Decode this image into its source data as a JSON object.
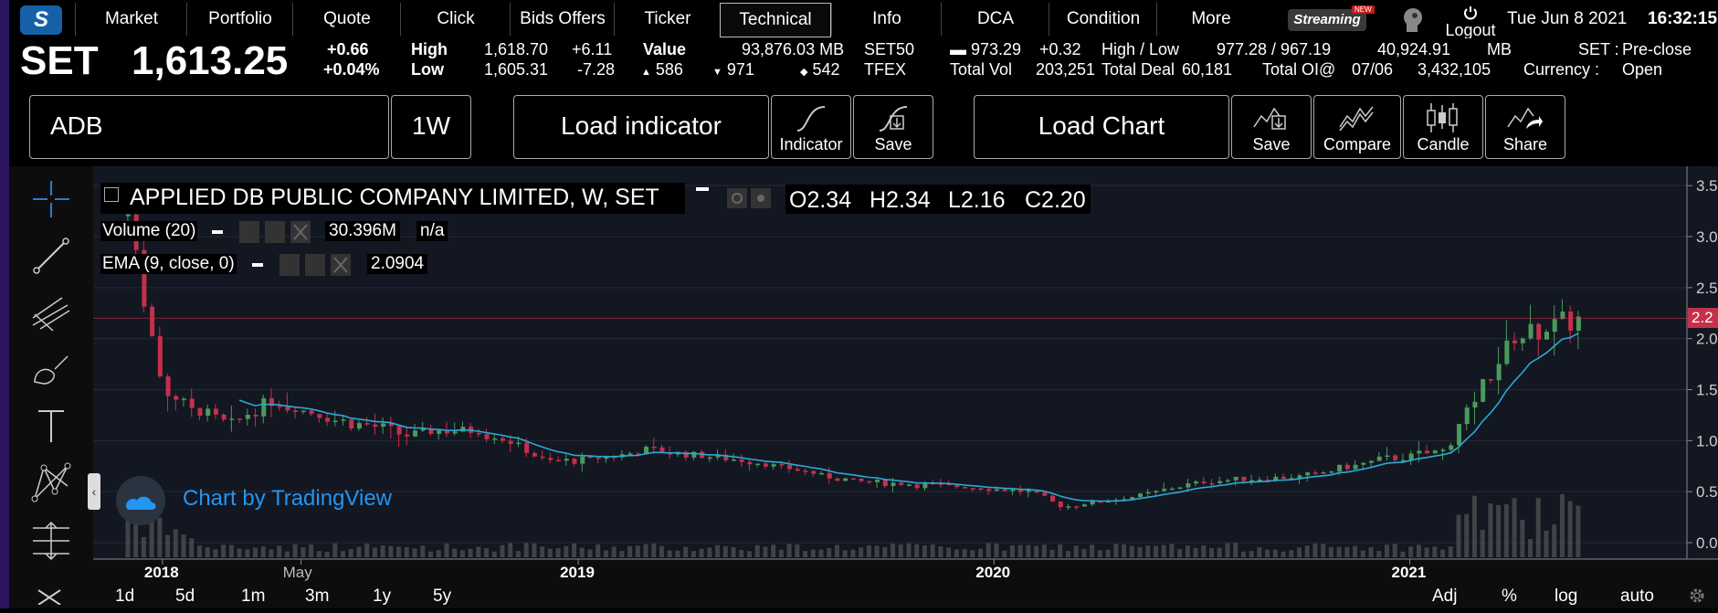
{
  "nav": {
    "logo_letter": "S",
    "items": [
      "Market",
      "Portfolio",
      "Quote",
      "Click",
      "Bids Offers",
      "Ticker",
      "Technical",
      "Info",
      "DCA",
      "Condition",
      "More"
    ],
    "active": "Technical",
    "streaming_label": "Streaming",
    "new_badge": "NEW",
    "logout_label": "Logout",
    "date": "Tue Jun 8 2021",
    "time": "16:32:15"
  },
  "market": {
    "index_name": "SET",
    "index_value": "1,613.25",
    "change": "+0.66",
    "change_pct": "+0.04%",
    "high_label": "High",
    "high_value": "1,618.70",
    "high_change": "+6.11",
    "low_label": "Low",
    "low_value": "1,605.31",
    "low_change": "-7.28",
    "value_label": "Value",
    "value_amount": "93,876.03 MB",
    "up_count": "586",
    "down_count": "971",
    "unchanged_count": "542",
    "set50_label": "SET50",
    "set50_value": "973.29",
    "set50_change": "+0.32",
    "highlow_label": "High / Low",
    "highlow_value": "977.28  /  967.19",
    "set50_amount": "40,924.91",
    "set50_unit": "MB",
    "set_status_label": "SET :",
    "set_status": "Pre-close",
    "tfex_label": "TFEX",
    "totalvol_label": "Total Vol",
    "totalvol_value": "203,251",
    "totaldeal_label": "Total Deal",
    "totaldeal_value": "60,181",
    "totaloi_label": "Total OI@",
    "totaloi_date": "07/06",
    "totaloi_value": "3,432,105",
    "currency_label": "Currency :",
    "currency_value": "Open"
  },
  "toolbar": {
    "symbol": "ADB",
    "interval": "1W",
    "load_indicator": "Load indicator",
    "indicator_btn": "Indicator",
    "save_btn": "Save",
    "load_chart": "Load Chart",
    "save_chart_btn": "Save",
    "compare_btn": "Compare",
    "candle_btn": "Candle",
    "share_btn": "Share"
  },
  "chart_legend": {
    "title": "APPLIED DB PUBLIC COMPANY LIMITED, W, SET",
    "open": "O2.34",
    "high": "H2.34",
    "low": "L2.16",
    "close": "C2.20",
    "volume_label": "Volume (20)",
    "volume_value": "30.396M",
    "volume_ma": "n/a",
    "ema_label": "EMA (9, close, 0)",
    "ema_value": "2.0904",
    "watermark": "Chart by TradingView",
    "price_tag": "2.2"
  },
  "chart_data": {
    "type": "candlestick",
    "x_ticks": [
      "2018",
      "May",
      "2019",
      "2020",
      "2021"
    ],
    "y_ticks": [
      "3.5",
      "3.0",
      "2.5",
      "2.0",
      "1.5",
      "1.0",
      "0.5",
      "0.0"
    ],
    "ylim": [
      0,
      3.6
    ],
    "last_price": 2.2,
    "close_series": [
      {
        "x": "2017-12",
        "y": 3.2
      },
      {
        "x": "2018-01",
        "y": 1.5
      },
      {
        "x": "2018-02",
        "y": 1.3
      },
      {
        "x": "2018-03",
        "y": 1.15
      },
      {
        "x": "2018-04",
        "y": 1.4
      },
      {
        "x": "2018-05",
        "y": 1.3
      },
      {
        "x": "2018-06",
        "y": 1.2
      },
      {
        "x": "2018-07",
        "y": 1.15
      },
      {
        "x": "2018-08",
        "y": 1.05
      },
      {
        "x": "2018-09",
        "y": 1.1
      },
      {
        "x": "2018-10",
        "y": 1.1
      },
      {
        "x": "2018-11",
        "y": 1.0
      },
      {
        "x": "2018-12",
        "y": 0.8
      },
      {
        "x": "2019-01",
        "y": 0.8
      },
      {
        "x": "2019-03",
        "y": 0.9
      },
      {
        "x": "2019-06",
        "y": 0.8
      },
      {
        "x": "2019-09",
        "y": 0.6
      },
      {
        "x": "2019-12",
        "y": 0.55
      },
      {
        "x": "2020-02",
        "y": 0.5
      },
      {
        "x": "2020-03",
        "y": 0.35
      },
      {
        "x": "2020-05",
        "y": 0.45
      },
      {
        "x": "2020-07",
        "y": 0.6
      },
      {
        "x": "2020-10",
        "y": 0.65
      },
      {
        "x": "2020-12",
        "y": 0.8
      },
      {
        "x": "2021-02",
        "y": 0.9
      },
      {
        "x": "2021-03",
        "y": 1.5
      },
      {
        "x": "2021-04",
        "y": 2.0
      },
      {
        "x": "2021-05",
        "y": 2.1
      },
      {
        "x": "2021-06",
        "y": 2.2
      }
    ]
  },
  "timeframes": [
    "1d",
    "5d",
    "1m",
    "3m",
    "1y",
    "5y"
  ],
  "bottom_options": [
    "Adj",
    "%",
    "log",
    "auto"
  ],
  "colors": {
    "up": "#4a9a5c",
    "down": "#c5304a",
    "ema": "#2aa9d6",
    "accent": "#1561a8",
    "pane": "#131722"
  }
}
